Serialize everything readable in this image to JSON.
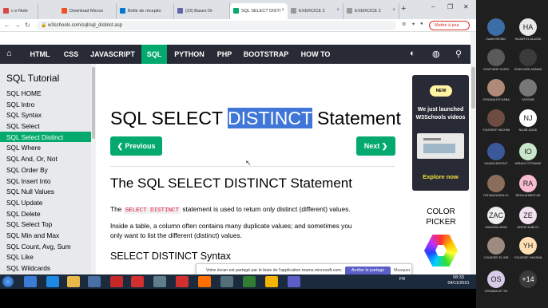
{
  "tabs": [
    {
      "label": "c e-Note",
      "color": "#d44"
    },
    {
      "label": "Download Micros",
      "color": "#f25022"
    },
    {
      "label": "Boîte de réceptio",
      "color": "#0078d4"
    },
    {
      "label": "(23) Bases Dr",
      "color": "#6264a7"
    },
    {
      "label": "SQL SELECT DISTI",
      "color": "#04aa6d"
    },
    {
      "label": "EXERCICE 2",
      "color": "#999"
    },
    {
      "label": "EXERCICE 2",
      "color": "#999"
    }
  ],
  "browser": {
    "url": "w3schools.com/sql/sql_distinct.asp",
    "mettre_label": "Mettre à jour",
    "new_tab": "+",
    "back": "←",
    "forward": "→",
    "reload": "↻"
  },
  "nav": {
    "items": [
      "HTML",
      "CSS",
      "JAVASCRIPT",
      "SQL",
      "PYTHON",
      "PHP",
      "BOOTSTRAP",
      "HOW TO"
    ]
  },
  "sidebar": {
    "title": "SQL Tutorial",
    "items": [
      "SQL HOME",
      "SQL Intro",
      "SQL Syntax",
      "SQL Select",
      "SQL Select Distinct",
      "SQL Where",
      "SQL And, Or, Not",
      "SQL Order By",
      "SQL Insert Into",
      "SQL Null Values",
      "SQL Update",
      "SQL Delete",
      "SQL Select Top",
      "SQL Min and Max",
      "SQL Count, Avg, Sum",
      "SQL Like",
      "SQL Wildcards"
    ],
    "active_index": 4
  },
  "main": {
    "title_before": "SQL SELECT ",
    "title_highlight": "DISTINCT",
    "title_after": " Statement",
    "prev_label": "❮ Previous",
    "next_label": "Next ❯",
    "section_title": "The SQL SELECT DISTINCT Statement",
    "p1_code": "SELECT DISTINCT",
    "p1_pre": "The ",
    "p1_post": " statement is used to return only distinct (different) values.",
    "p2_line1": "Inside a table, a column often contains many duplicate values; and sometimes you",
    "p2_line2": "only want to list the different (distinct) values.",
    "syntax_title": "SELECT DISTINCT Syntax"
  },
  "ad": {
    "badge": "NEW",
    "line1": "We just launched",
    "line2": "W3Schools videos",
    "cta": "Explore now"
  },
  "color_picker": {
    "line1": "COLOR",
    "line2": "PICKER"
  },
  "share_bar": {
    "message": "Votre écran est partagé par le biais de l'application teams.microsoft.com.",
    "stop_label": "Arrêter le partage",
    "hide_label": "Masquer"
  },
  "taskbar": {
    "time": "08:33",
    "date": "04/11/2021",
    "lang": "FR"
  },
  "participants": [
    {
      "initials": "",
      "name": "Zoubir BN BAT",
      "bg": "#3a6ea5"
    },
    {
      "initials": "HA",
      "name": "HAJAR EL ALAOUI",
      "bg": "#e8e8e8"
    },
    {
      "initials": "",
      "name": "SOUFIANE KASSI",
      "bg": "#5a5a5a"
    },
    {
      "initials": "",
      "name": "ZHAOUARI AMMAN",
      "bg": "#3b3b3b"
    },
    {
      "initials": "",
      "name": "OSSAMA ED DABA",
      "bg": "#b08a78"
    },
    {
      "initials": "",
      "name": "YASSINE",
      "bg": "#777"
    },
    {
      "initials": "",
      "name": "YOUSSEF HACHIM",
      "bg": "#6d4c41"
    },
    {
      "initials": "NJ",
      "name": "NAJIB JADID",
      "bg": "#ffffff"
    },
    {
      "initials": "",
      "name": "HAMZA BATOUT",
      "bg": "#3b5998"
    },
    {
      "initials": "IO",
      "name": "IMRANI OTTMANE",
      "bg": "#c8e6c9"
    },
    {
      "initials": "",
      "name": "FATIMAZAHRA EL",
      "bg": "#8a6d5a"
    },
    {
      "initials": "RA",
      "name": "REDA AHMED AS",
      "bg": "#f8bbd0"
    },
    {
      "initials": "ZAC",
      "name": "ZAKARIA HEAR",
      "bg": "#eeeeee"
    },
    {
      "initials": "ZE",
      "name": "ZINEB HAIBI EL",
      "bg": "#f0e0f0"
    },
    {
      "initials": "",
      "name": "YOUSSEF EL IBR",
      "bg": "#9e8a80"
    },
    {
      "initials": "YH",
      "name": "YOUSSEF HASSAN",
      "bg": "#ffe0b2"
    },
    {
      "initials": "OS",
      "name": "OSSAMA AIT SA",
      "bg": "#d7c9e8"
    },
    {
      "initials": "+14",
      "name": "",
      "bg": "#3a3a3a"
    }
  ]
}
